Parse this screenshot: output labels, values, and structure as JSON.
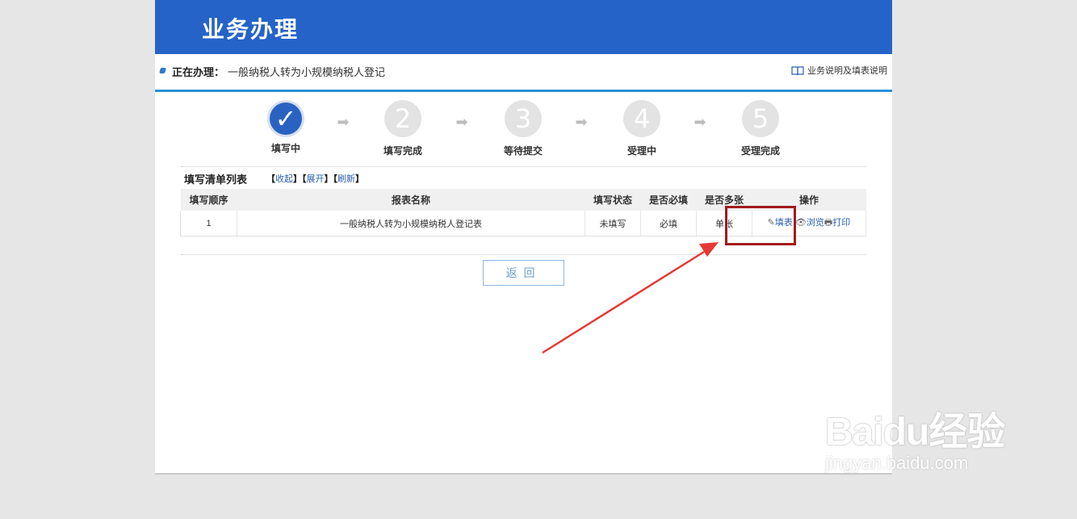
{
  "banner": {
    "title": "业务办理"
  },
  "info": {
    "current_label": "正在办理：",
    "current_value": "一般纳税人转为小规模纳税人登记",
    "help_link": "业务说明及填表说明"
  },
  "steps": [
    {
      "number": "✓",
      "label": "填写中",
      "state": "done"
    },
    {
      "number": "2",
      "label": "填写完成",
      "state": "pending"
    },
    {
      "number": "3",
      "label": "等待提交",
      "state": "pending"
    },
    {
      "number": "4",
      "label": "受理中",
      "state": "pending"
    },
    {
      "number": "5",
      "label": "受理完成",
      "state": "pending"
    }
  ],
  "list": {
    "title": "填写清单列表",
    "collapse": "收起",
    "expand": "展开",
    "refresh": "刷新"
  },
  "table": {
    "headers": [
      "填写顺序",
      "报表名称",
      "填写状态",
      "是否必填",
      "是否多张",
      "操作"
    ],
    "rows": [
      {
        "order": "1",
        "name": "一般纳税人转为小规模纳税人登记表",
        "status": "未填写",
        "required": "必填",
        "multi": "单张",
        "actions": {
          "fill": "填表",
          "view": "浏览",
          "print": "打印"
        }
      }
    ]
  },
  "buttons": {
    "return": "返回"
  },
  "watermark": {
    "logo": "Baidu经验",
    "url": "jingyan.baidu.com"
  },
  "colors": {
    "banner": "#2563c8",
    "link": "#2a5fb0",
    "highlight": "#a31b1b",
    "annotation_arrow": "#e53935"
  }
}
